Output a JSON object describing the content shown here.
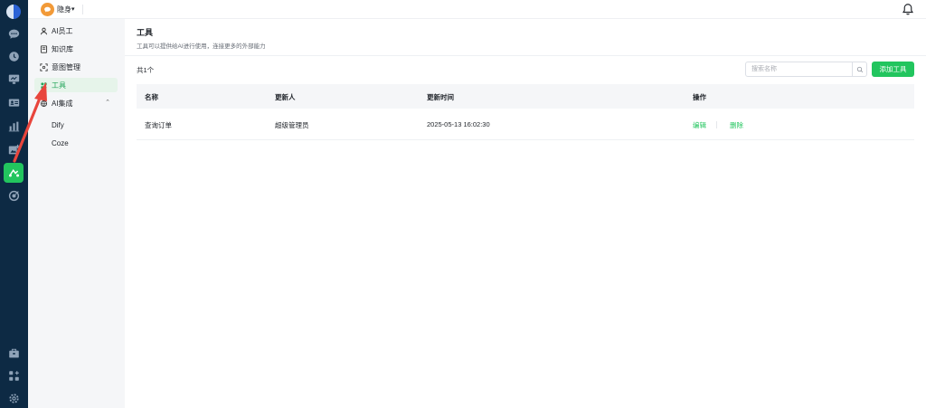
{
  "topbar": {
    "workspace_name": "隐身",
    "workspace_caret": "▾"
  },
  "rail": {
    "icons": [
      "logo",
      "chat-icon",
      "history-icon",
      "monitor-icon",
      "contact-card-icon",
      "bar-chart-icon",
      "image-add-icon",
      "ai-tools-icon",
      "target-icon",
      "briefcase-icon",
      "apps-icon",
      "settings-icon"
    ],
    "active": "ai-tools-icon"
  },
  "sidebar": {
    "items": [
      {
        "label": "AI员工",
        "icon": "user-icon"
      },
      {
        "label": "知识库",
        "icon": "book-icon"
      },
      {
        "label": "意图管理",
        "icon": "scan-icon"
      },
      {
        "label": "工具",
        "icon": "tool-icon",
        "active": true
      },
      {
        "label": "AI集成",
        "icon": "integration-icon",
        "expanded": true
      }
    ],
    "sub_items": [
      {
        "label": "Dify"
      },
      {
        "label": "Coze"
      }
    ],
    "caret": "⌃"
  },
  "page": {
    "title": "工具",
    "description": "工具可以提供给AI进行使用，连接更多的外部能力",
    "total": "共1个",
    "search": {
      "placeholder": "搜索名称",
      "value": ""
    },
    "add_button": "添加工具"
  },
  "table": {
    "columns": [
      "名称",
      "更新人",
      "更新时间",
      "操作"
    ],
    "rows": [
      {
        "name": "查询订单",
        "updater": "超级管理员",
        "updated_at": "2025-05-13 16:02:30",
        "actions": [
          "编辑",
          "删除"
        ]
      }
    ]
  },
  "colors": {
    "accent": "#22c55e",
    "rail_bg": "#0d2a44",
    "sidebar_bg": "#f5f6f8",
    "annotation": "#e8453c"
  }
}
